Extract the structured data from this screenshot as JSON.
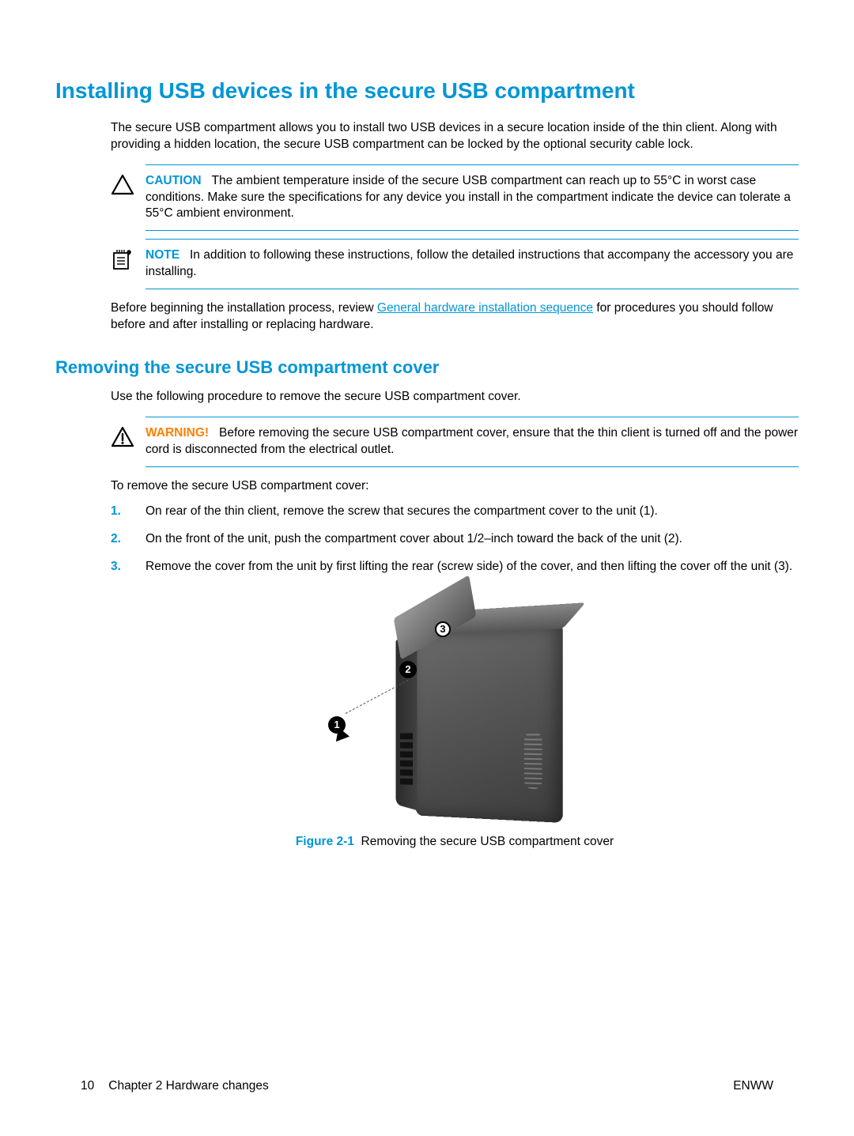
{
  "heading": "Installing USB devices in the secure USB compartment",
  "intro": "The secure USB compartment allows you to install two USB devices in a secure location inside of the thin client. Along with providing a hidden location, the secure USB compartment can be locked by the optional security cable lock.",
  "caution": {
    "label": "CAUTION",
    "text": "The ambient temperature inside of the secure USB compartment can reach up to 55°C in worst case conditions. Make sure the specifications for any device you install in the compartment indicate the device can tolerate a 55°C ambient environment."
  },
  "note": {
    "label": "NOTE",
    "text": "In addition to following these instructions, follow the detailed instructions that accompany the accessory you are installing."
  },
  "before_begin_pre": "Before beginning the installation process, review ",
  "before_begin_link": "General hardware installation sequence",
  "before_begin_post": " for procedures you should follow before and after installing or replacing hardware.",
  "sub_heading": "Removing the secure USB compartment cover",
  "sub_intro": "Use the following procedure to remove the secure USB compartment cover.",
  "warning": {
    "label": "WARNING!",
    "text": "Before removing the secure USB compartment cover, ensure that the thin client is turned off and the power cord is disconnected from the electrical outlet."
  },
  "to_remove": "To remove the secure USB compartment cover:",
  "steps": [
    {
      "num": "1.",
      "text": "On rear of the thin client, remove the screw that secures the compartment cover to the unit (1)."
    },
    {
      "num": "2.",
      "text": "On the front of the unit, push the compartment cover about 1/2–inch toward the back of the unit (2)."
    },
    {
      "num": "3.",
      "text": "Remove the cover from the unit by first lifting the rear (screw side) of the cover, and then lifting the cover off the unit (3)."
    }
  ],
  "figure": {
    "label": "Figure 2-1",
    "caption": "Removing the secure USB compartment cover",
    "callouts": {
      "c1": "1",
      "c2": "2",
      "c3": "3"
    }
  },
  "footer": {
    "page_num": "10",
    "chapter": "Chapter 2   Hardware changes",
    "doc_code": "ENWW"
  }
}
